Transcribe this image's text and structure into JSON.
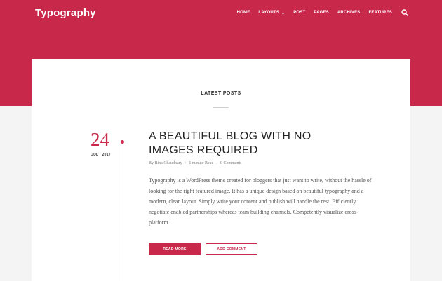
{
  "header": {
    "site_title": "Typography",
    "nav": [
      {
        "label": "HOME"
      },
      {
        "label": "LAYOUTS",
        "has_dropdown": true
      },
      {
        "label": "POST"
      },
      {
        "label": "PAGES"
      },
      {
        "label": "ARCHIVES"
      },
      {
        "label": "FEATURES"
      }
    ],
    "search_icon": "search-icon"
  },
  "main": {
    "section_title": "LATEST POSTS",
    "post": {
      "day": "24",
      "month_year": "JUL · 2017",
      "title": "A BEAUTIFUL BLOG WITH NO IMAGES REQUIRED",
      "author": "By Rina Chaudhary",
      "read_time": "1 minute Read",
      "comments": "0 Comments",
      "excerpt": "Typography is a WordPress theme created for bloggers that just want to write, without the hassle of looking for the right featured image. It has a unique design based on beautiful typography and a modern, clean layout. Simply write your content and publish will handle the rest. Efficiently negotiate enabled partnerships whereas team building channels. Competently visualize cross-platform...",
      "read_more": "READ MORE",
      "add_comment": "ADD COMMENT"
    }
  },
  "colors": {
    "accent": "#c8284a",
    "background": "#f4f4f4",
    "card": "#ffffff"
  }
}
